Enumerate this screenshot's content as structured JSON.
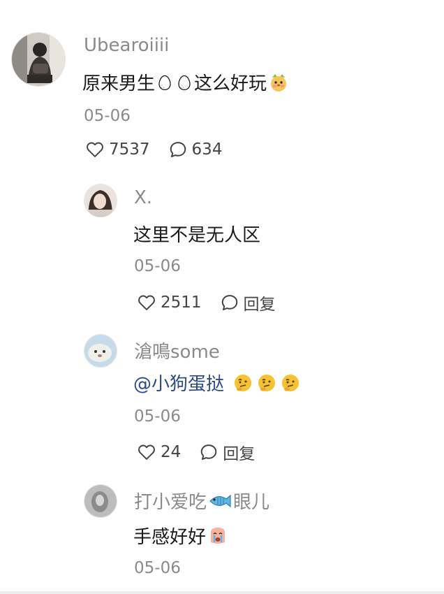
{
  "comments": [
    {
      "username": "Ubearoiiii",
      "text_before": "原来男生",
      "text_after": "这么好玩",
      "date": "05-06",
      "likes": "7537",
      "replies": "634",
      "icons": [
        "egg-emoji",
        "egg-emoji",
        "dog-face-emoji"
      ]
    },
    {
      "username": "X.",
      "text": "这里不是无人区",
      "date": "05-06",
      "likes": "2511",
      "reply_label": "回复"
    },
    {
      "username": "滄鳴some",
      "mention": "@小狗蛋挞",
      "date": "05-06",
      "likes": "24",
      "reply_label": "回复",
      "icons": [
        "thinking-face-emoji",
        "thinking-face-emoji",
        "thinking-face-emoji"
      ]
    },
    {
      "username_before": "打小爱吃",
      "username_after": "眼儿",
      "text": "手感好好",
      "date": "05-06",
      "icons": [
        "fish-emoji",
        "crying-face-emoji"
      ]
    }
  ]
}
